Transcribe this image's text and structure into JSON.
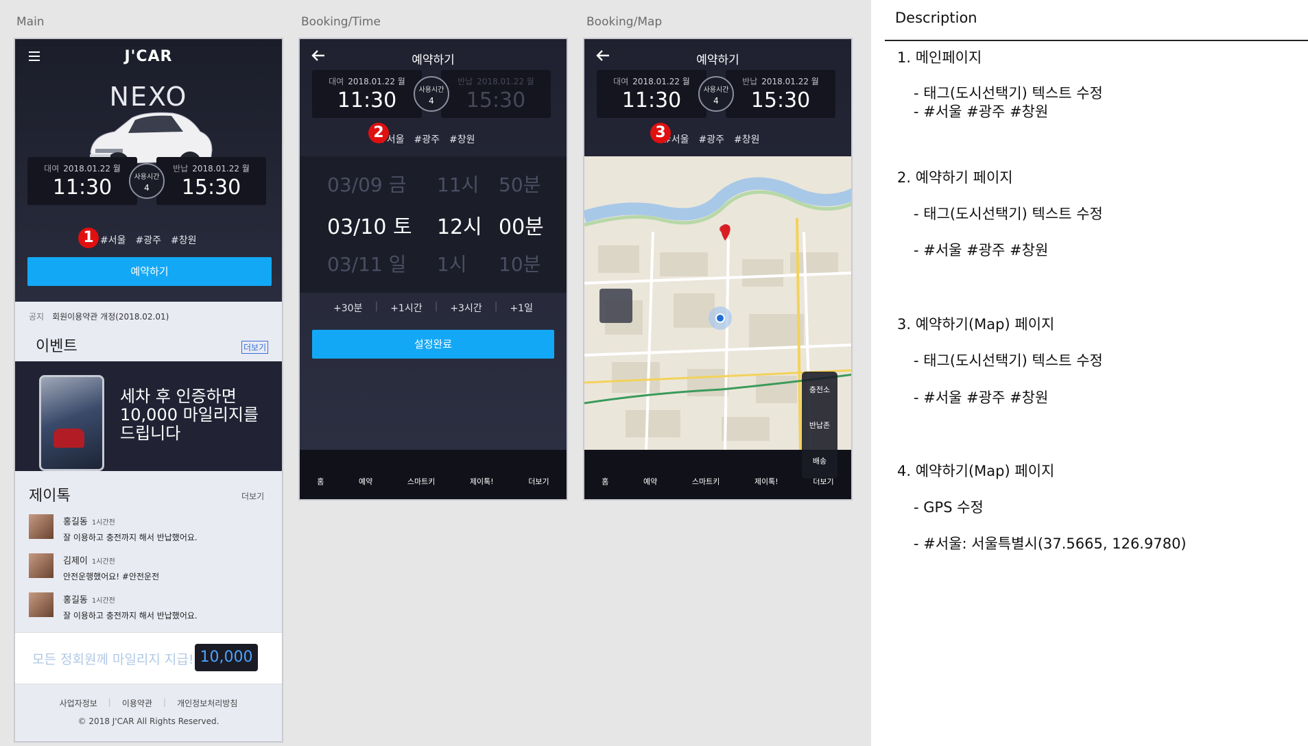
{
  "frames": {
    "main_label": "Main",
    "booking_label": "Booking/Time",
    "map_label": "Booking/Map"
  },
  "main": {
    "logo": "J'CAR",
    "model": "NEXO",
    "rent_label": "대여",
    "rent_date": "2018.01.22 월",
    "rent_time": "11:30",
    "usage_label": "사용시간",
    "usage_value": "4",
    "return_label": "반납",
    "return_date": "2018.01.22 월",
    "return_time": "15:30",
    "tags": [
      "#서울",
      "#광주",
      "#창원"
    ],
    "badge": "1",
    "reserve_button": "예약하기",
    "notice_label": "공지",
    "notice_text": "회원이용약관 개정(2018.02.01)",
    "event_title": "이벤트",
    "event_more": "더보기",
    "event_text_1": "세차 후 인증하면",
    "event_text_2": "10,000 마일리지를",
    "event_text_3": "드립니다",
    "jtalk_title": "제이톡",
    "jtalk_more": "더보기",
    "talks": [
      {
        "name": "홍길동",
        "time": "1시간전",
        "msg": "잘 이용하고 충전까지 해서 반납했어요."
      },
      {
        "name": "김제이",
        "time": "1시간전",
        "msg": "안전운행했어요! #안전운전"
      },
      {
        "name": "홍길동",
        "time": "1시간전",
        "msg": "잘 이용하고 충전까지 해서 반납했어요."
      }
    ],
    "mileage_text": "모든 정회원께 마일리지 지급!",
    "mileage_value": "10,000",
    "footer_links": [
      "사업자정보",
      "이용약관",
      "개인정보처리방침"
    ],
    "copyright": "© 2018 J'CAR All Rights Reserved."
  },
  "booking": {
    "title": "예약하기",
    "rent_label": "대여",
    "rent_date": "2018.01.22 월",
    "rent_time": "11:30",
    "usage_label": "사용시간",
    "usage_value": "4",
    "return_label": "반납",
    "return_date": "2018.01.22 월",
    "return_time": "15:30",
    "tags": [
      "#서울",
      "#광주",
      "#창원"
    ],
    "badge": "2",
    "picker_prev": [
      "03/09 금",
      "11시",
      "50분"
    ],
    "picker_sel": [
      "03/10 토",
      "12시",
      "00분"
    ],
    "picker_next": [
      "03/11 일",
      "1시",
      "10분"
    ],
    "quick": [
      "+30분",
      "+1시간",
      "+3시간",
      "+1일"
    ],
    "confirm_button": "설정완료",
    "nav": [
      "홈",
      "예약",
      "스마트키",
      "제이톡!",
      "더보기"
    ]
  },
  "mapscreen": {
    "title": "예약하기",
    "rent_label": "대여",
    "rent_date": "2018.01.22 월",
    "rent_time": "11:30",
    "usage_label": "사용시간",
    "usage_value": "4",
    "return_label": "반납",
    "return_date": "2018.01.22 월",
    "return_time": "15:30",
    "tags": [
      "#서울",
      "#광주",
      "#창원"
    ],
    "badge": "3",
    "side": [
      "충전소",
      "반납존",
      "배송"
    ],
    "nav": [
      "홈",
      "예약",
      "스마트키",
      "제이톡!",
      "더보기"
    ]
  },
  "description": {
    "title": "Description",
    "s1": "1. 메인페이지",
    "s1a": "- 태그(도시선택기) 텍스트 수정",
    "s1b": "- #서울 #광주 #창원",
    "s2": "2. 예약하기 페이지",
    "s2a": "- 태그(도시선택기) 텍스트 수정",
    "s2b": "- #서울 #광주 #창원",
    "s3": "3. 예약하기(Map) 페이지",
    "s3a": "- 태그(도시선택기) 텍스트 수정",
    "s3b": "- #서울 #광주 #창원",
    "s4": "4. 예약하기(Map) 페이지",
    "s4a": "- GPS 수정",
    "s4b": "- #서울: 서울특별시(37.5665, 126.9780)"
  },
  "colors": {
    "accent_blue": "#13a8f5",
    "badge_red": "#e01010",
    "dark_bg": "#1f2130"
  }
}
